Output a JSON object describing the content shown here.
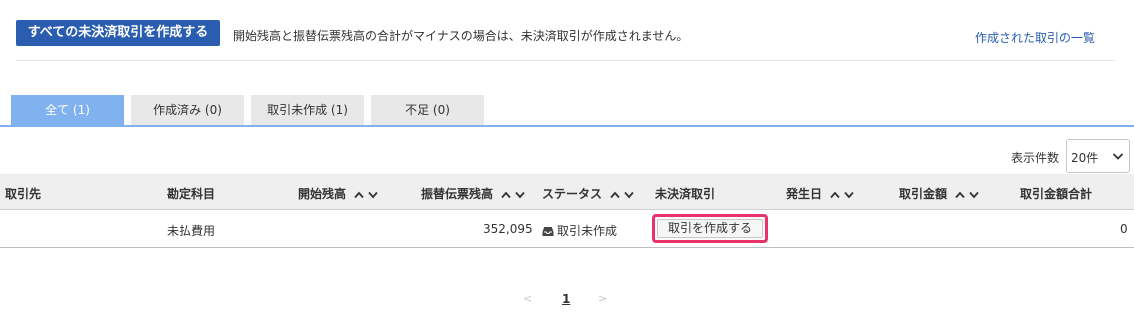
{
  "toolbar": {
    "create_all_label": "すべての未決済取引を作成する",
    "notice": "開始残高と振替伝票残高の合計がマイナスの場合は、未決済取引が作成されません。",
    "created_list_link": "作成された取引の一覧"
  },
  "tabs": [
    {
      "label": "全て (1)",
      "active": true
    },
    {
      "label": "作成済み (0)",
      "active": false
    },
    {
      "label": "取引未作成 (1)",
      "active": false
    },
    {
      "label": "不足 (0)",
      "active": false
    }
  ],
  "per_page": {
    "label": "表示件数",
    "value": "20件"
  },
  "table": {
    "columns": [
      "取引先",
      "勘定科目",
      "開始残高",
      "振替伝票残高",
      "ステータス",
      "未決済取引",
      "発生日",
      "取引金額",
      "取引金額合計"
    ],
    "rows": [
      {
        "partner": "",
        "account": "未払費用",
        "opening_balance": "",
        "transfer_balance": "352,095",
        "status": "取引未作成",
        "action_label": "取引を作成する",
        "date": "",
        "amount": "",
        "amount_total": "0"
      }
    ]
  },
  "pagination": {
    "prev": "<",
    "current": "1",
    "next": ">"
  },
  "colors": {
    "primary": "#2a5db0",
    "tab_active": "#7fb2ee",
    "highlight": "#e8326a"
  }
}
